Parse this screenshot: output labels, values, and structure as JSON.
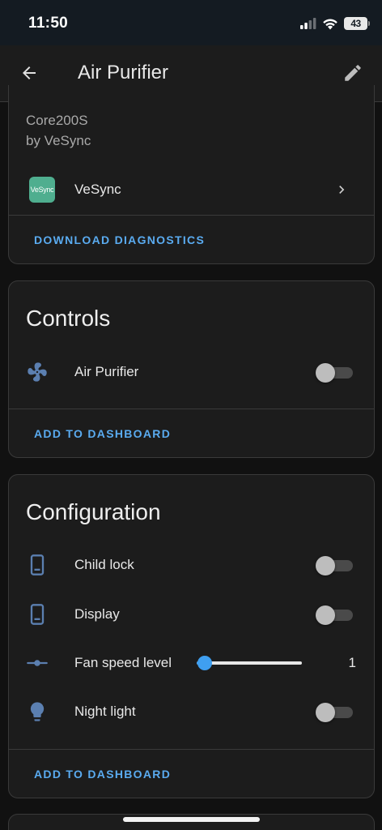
{
  "status_bar": {
    "time": "11:50",
    "battery": "43",
    "icons": [
      "cellular-signal-icon",
      "wifi-icon",
      "battery-icon"
    ]
  },
  "app_bar": {
    "title": "Air Purifier",
    "back_icon": "arrow-left-icon",
    "edit_icon": "pencil-icon"
  },
  "device_info": {
    "model": "Core200S",
    "manufacturer": "by VeSync",
    "integration": {
      "logo_text": "VeSync",
      "name": "VeSync"
    },
    "action": "DOWNLOAD DIAGNOSTICS"
  },
  "controls": {
    "title": "Controls",
    "entities": [
      {
        "name": "Air Purifier",
        "icon": "fan-icon",
        "state": "off"
      }
    ],
    "action": "ADD TO DASHBOARD"
  },
  "configuration": {
    "title": "Configuration",
    "entities": [
      {
        "name": "Child lock",
        "icon": "tablet-icon",
        "state": "off"
      },
      {
        "name": "Display",
        "icon": "tablet-icon",
        "state": "off"
      },
      {
        "name": "Fan speed level",
        "icon": "slider-icon",
        "value": "1",
        "fraction": 0.0
      },
      {
        "name": "Night light",
        "icon": "lightbulb-icon",
        "state": "off"
      }
    ],
    "action": "ADD TO DASHBOARD"
  },
  "colors": {
    "accent": "#5aabf0",
    "slider": "#3f9ff0",
    "icon": "#5b7fb0",
    "card": "#1c1c1c",
    "background": "#111111"
  }
}
